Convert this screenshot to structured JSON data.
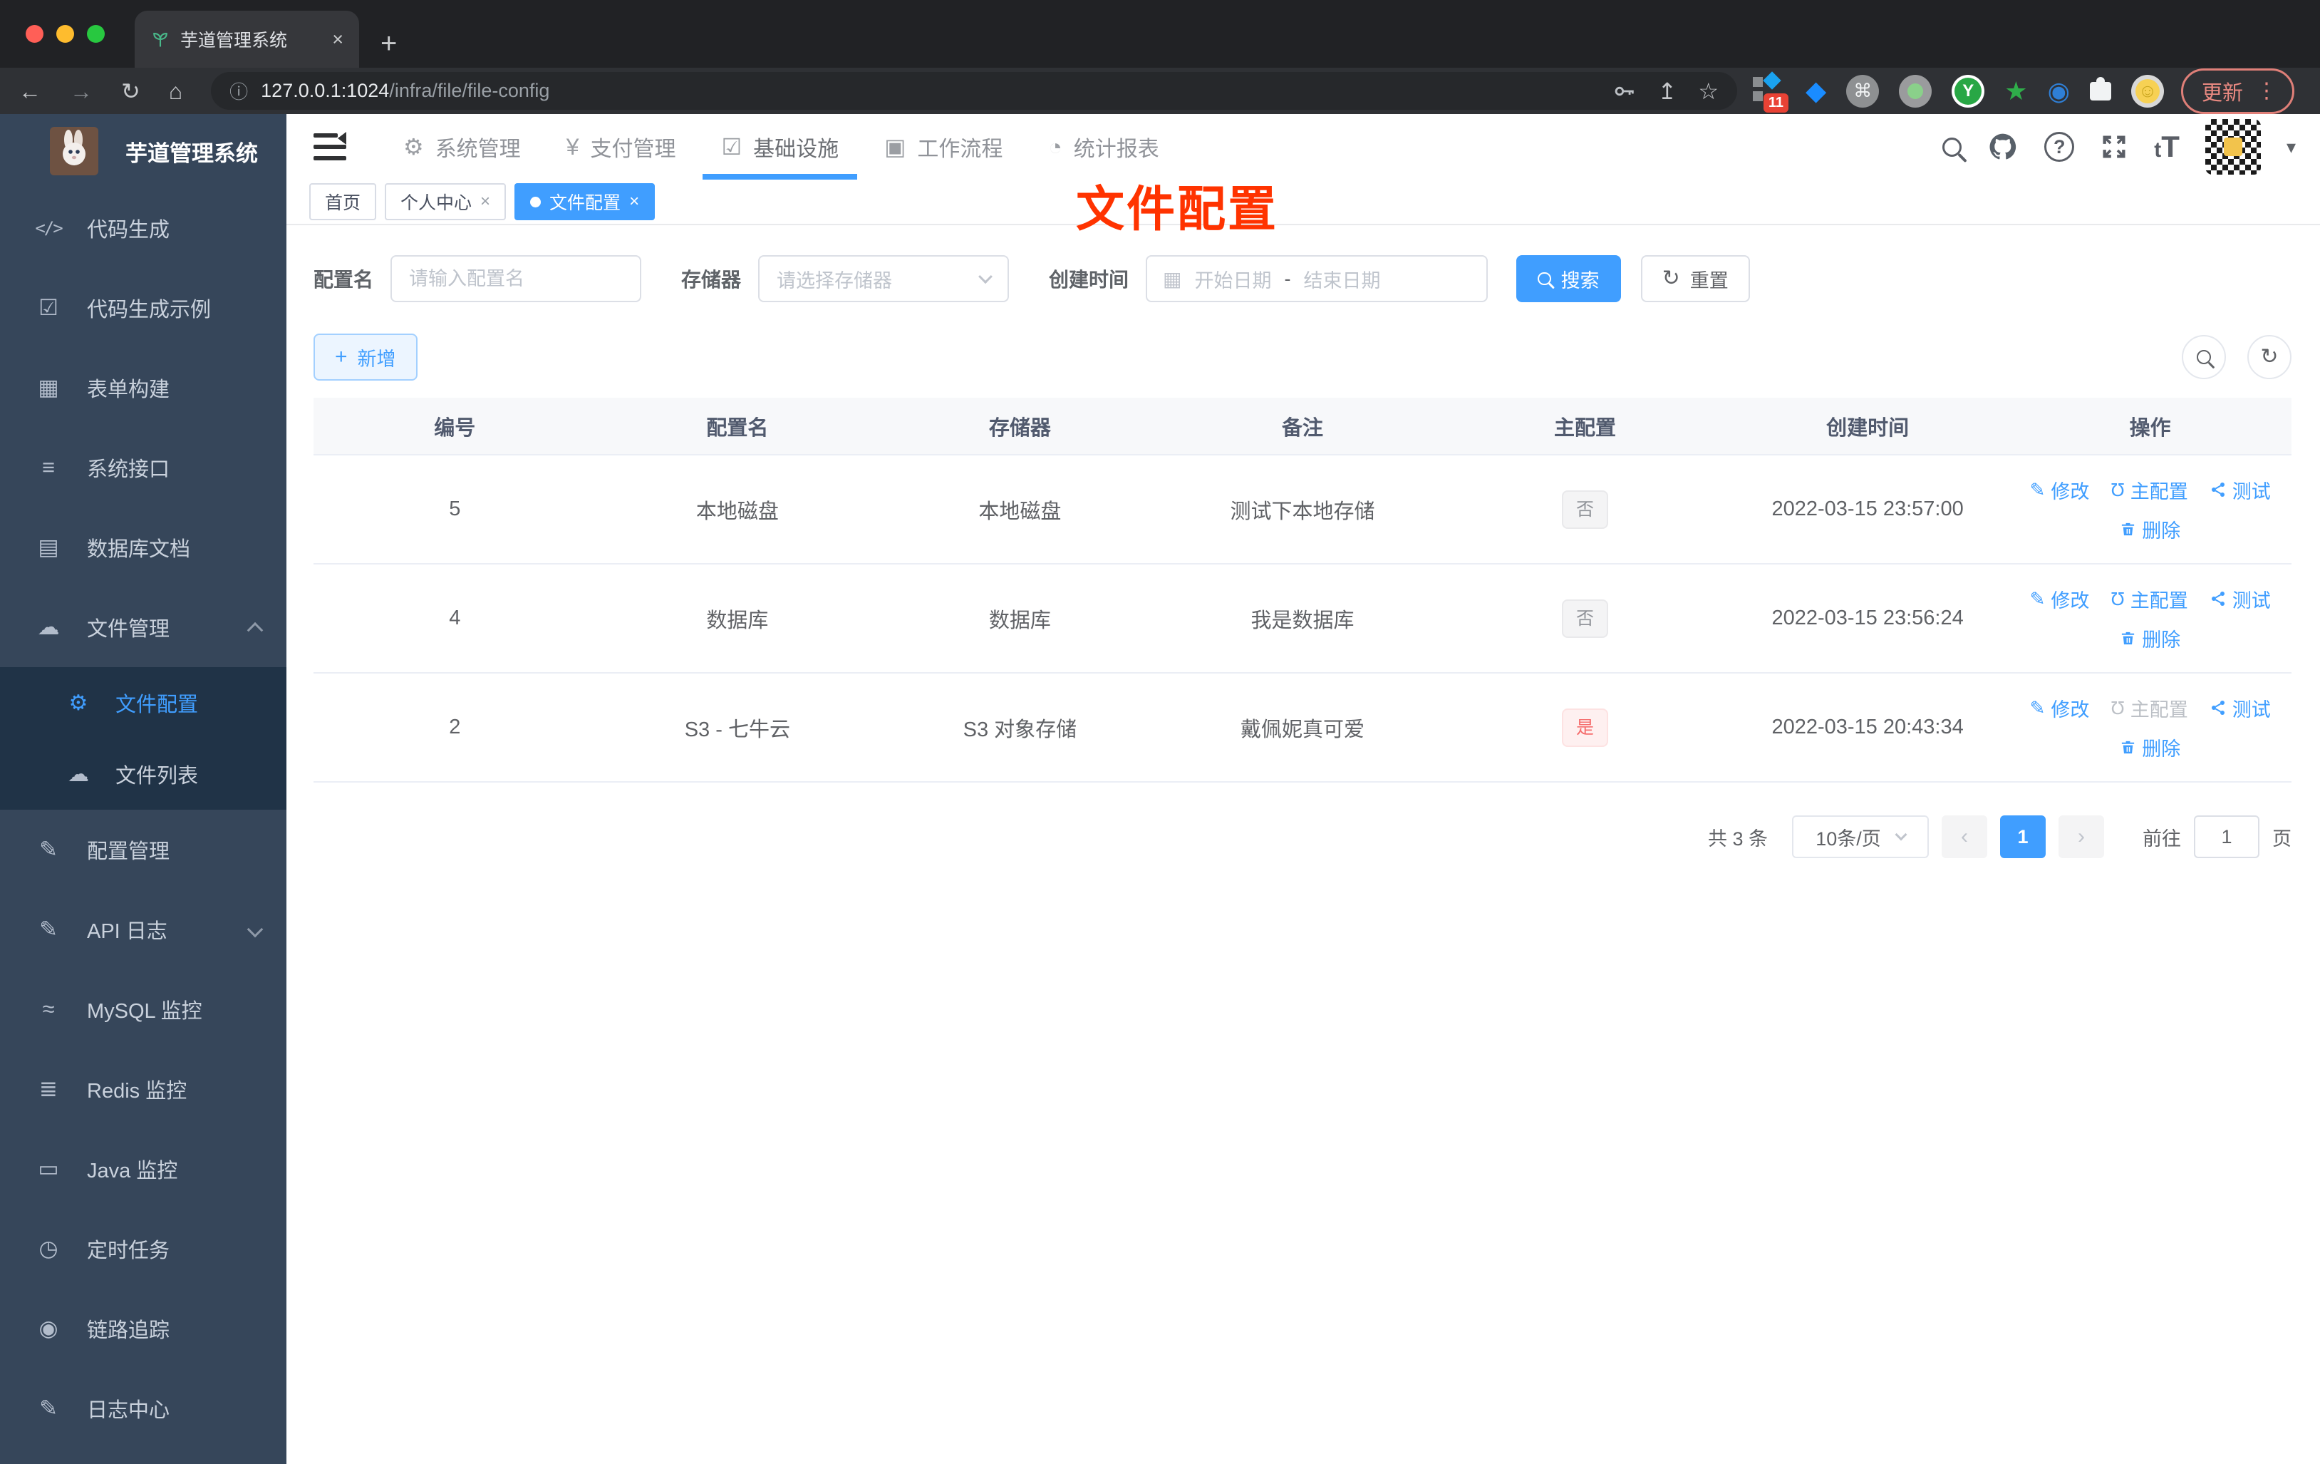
{
  "browser": {
    "tab_title": "芋道管理系统",
    "close_glyph": "×",
    "url_host": "127.0.0.1:1024",
    "url_path": "/infra/file/file-config",
    "update_label": "更新",
    "ext_badge": "11"
  },
  "icons": {
    "code": "</>",
    "example": "☑",
    "form": "▦",
    "api": "≡",
    "dbdoc": "▤",
    "filemgr": "☁",
    "fileconf": "⚙",
    "filelist": "☁",
    "confmgr": "✎",
    "apilog": "✎",
    "mysql": "≈",
    "redis": "≣",
    "java": "▭",
    "job": "◷",
    "trace": "◉",
    "logcenter": "✎",
    "nav_sys": "⚙",
    "nav_pay": "¥",
    "nav_infra": "☑",
    "nav_flow": "▣",
    "nav_report": "◔",
    "back": "←",
    "fwd": "→",
    "reload": "↻",
    "home": "⌂",
    "info": "ⓘ",
    "upload": "↥",
    "star": "☆",
    "cmd": "⌘",
    "smile": "☺",
    "eye": "◉",
    "greenstar": "★",
    "kebab": "⋮",
    "help": "?",
    "caret": "▾",
    "font_small": "t",
    "font_big": "T",
    "calendar": "▦",
    "refresh": "↻",
    "plus": "+",
    "magnet": "Ʊ",
    "pencil": "✎",
    "prev": "‹",
    "next": "›"
  },
  "sidebar": {
    "title": "芋道管理系统",
    "items": [
      {
        "label": "代码生成"
      },
      {
        "label": "代码生成示例"
      },
      {
        "label": "表单构建"
      },
      {
        "label": "系统接口"
      },
      {
        "label": "数据库文档"
      },
      {
        "label": "文件管理"
      },
      {
        "label": "文件配置"
      },
      {
        "label": "文件列表"
      },
      {
        "label": "配置管理"
      },
      {
        "label": "API 日志"
      },
      {
        "label": "MySQL 监控"
      },
      {
        "label": "Redis 监控"
      },
      {
        "label": "Java 监控"
      },
      {
        "label": "定时任务"
      },
      {
        "label": "链路追踪"
      },
      {
        "label": "日志中心"
      }
    ]
  },
  "header": {
    "nav": [
      {
        "label": "系统管理"
      },
      {
        "label": "支付管理"
      },
      {
        "label": "基础设施"
      },
      {
        "label": "工作流程"
      },
      {
        "label": "统计报表"
      }
    ]
  },
  "tabs": [
    {
      "label": "首页"
    },
    {
      "label": "个人中心"
    },
    {
      "label": "文件配置"
    }
  ],
  "overlay_title": "文件配置",
  "filters": {
    "name_label": "配置名",
    "name_placeholder": "请输入配置名",
    "storage_label": "存储器",
    "storage_placeholder": "请选择存储器",
    "time_label": "创建时间",
    "start_placeholder": "开始日期",
    "range_separator": "-",
    "end_placeholder": "结束日期",
    "search_label": "搜索",
    "reset_label": "重置"
  },
  "toolbar": {
    "add_label": "新增"
  },
  "table": {
    "headers": [
      "编号",
      "配置名",
      "存储器",
      "备注",
      "主配置",
      "创建时间",
      "操作"
    ],
    "actions": {
      "edit": "修改",
      "master": "主配置",
      "test": "测试",
      "delete": "删除"
    },
    "rows": [
      {
        "id": "5",
        "name": "本地磁盘",
        "storage": "本地磁盘",
        "remark": "测试下本地存储",
        "master": "否",
        "created": "2022-03-15 23:57:00"
      },
      {
        "id": "4",
        "name": "数据库",
        "storage": "数据库",
        "remark": "我是数据库",
        "master": "否",
        "created": "2022-03-15 23:56:24"
      },
      {
        "id": "2",
        "name": "S3 - 七牛云",
        "storage": "S3 对象存储",
        "remark": "戴佩妮真可爱",
        "master": "是",
        "created": "2022-03-15 20:43:34"
      }
    ]
  },
  "pagination": {
    "total": "共 3 条",
    "page_size": "10条/页",
    "current": "1",
    "goto_label": "前往",
    "goto_value": "1",
    "unit_label": "页"
  }
}
